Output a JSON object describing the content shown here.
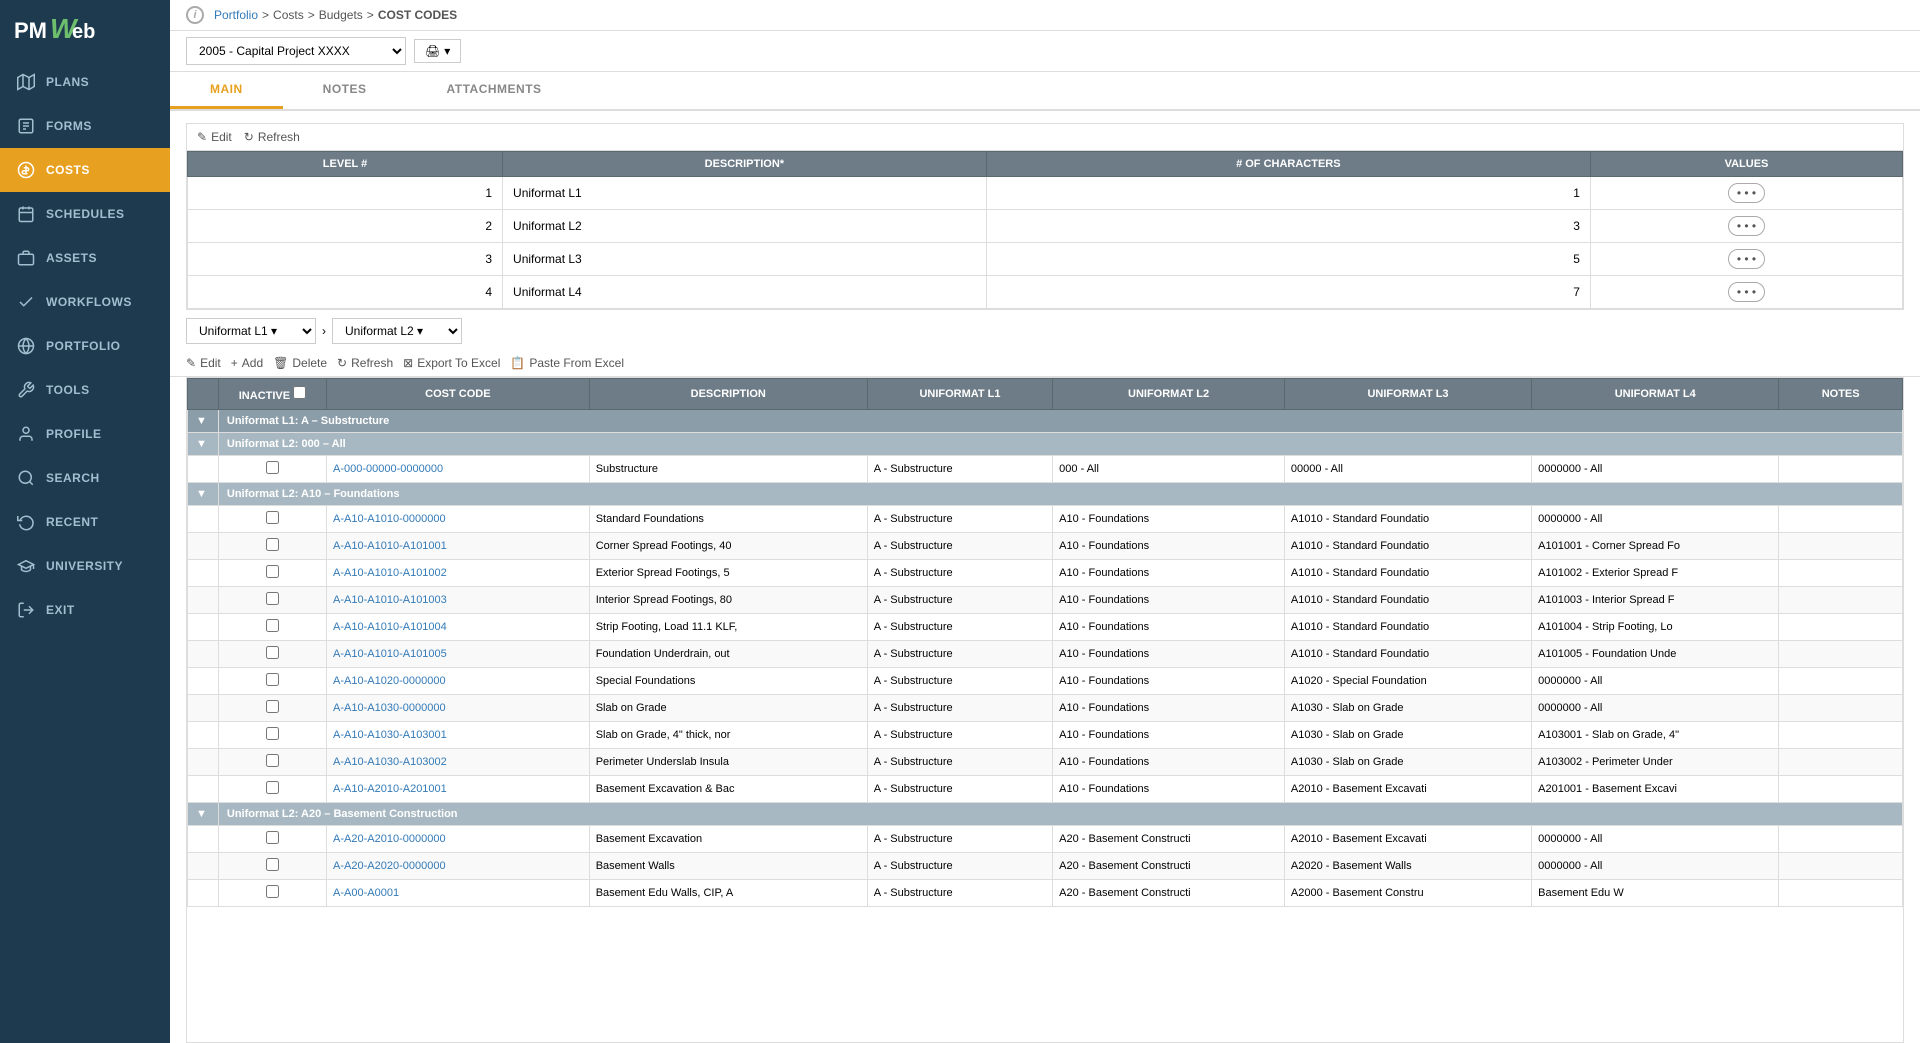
{
  "sidebar": {
    "logo_text": "PMWeb",
    "items": [
      {
        "id": "plans",
        "label": "PLANS",
        "icon": "map-icon"
      },
      {
        "id": "forms",
        "label": "FORMS",
        "icon": "forms-icon"
      },
      {
        "id": "costs",
        "label": "COSTS",
        "icon": "dollar-icon",
        "active": true
      },
      {
        "id": "schedules",
        "label": "SCHEDULES",
        "icon": "calendar-icon"
      },
      {
        "id": "assets",
        "label": "ASSETS",
        "icon": "assets-icon"
      },
      {
        "id": "workflows",
        "label": "WORKFLOWS",
        "icon": "check-icon"
      },
      {
        "id": "portfolio",
        "label": "PORTFOLIO",
        "icon": "globe-icon"
      },
      {
        "id": "tools",
        "label": "TOOLS",
        "icon": "tools-icon"
      },
      {
        "id": "profile",
        "label": "PROFILE",
        "icon": "profile-icon"
      },
      {
        "id": "search",
        "label": "SEARCH",
        "icon": "search-icon"
      },
      {
        "id": "recent",
        "label": "RECENT",
        "icon": "recent-icon"
      },
      {
        "id": "university",
        "label": "UNIVERSITY",
        "icon": "university-icon"
      },
      {
        "id": "exit",
        "label": "EXIT",
        "icon": "exit-icon"
      }
    ]
  },
  "breadcrumb": {
    "portfolio": "Portfolio",
    "costs": "Costs",
    "budgets": "Budgets",
    "page": "COST CODES"
  },
  "project_select": {
    "value": "2005 - Capital Project XXXX"
  },
  "tabs": [
    {
      "id": "main",
      "label": "MAIN",
      "active": true
    },
    {
      "id": "notes",
      "label": "NOTES",
      "active": false
    },
    {
      "id": "attachments",
      "label": "ATTACHMENTS",
      "active": false
    }
  ],
  "settings_section": {
    "edit_label": "Edit",
    "refresh_label": "Refresh",
    "columns": [
      "LEVEL #",
      "DESCRIPTION*",
      "# OF CHARACTERS",
      "VALUES"
    ],
    "rows": [
      {
        "level": "1",
        "description": "Uniformat L1",
        "chars": "1",
        "values": "..."
      },
      {
        "level": "2",
        "description": "Uniformat L2",
        "chars": "3",
        "values": "..."
      },
      {
        "level": "3",
        "description": "Uniformat L3",
        "chars": "5",
        "values": "..."
      },
      {
        "level": "4",
        "description": "Uniformat L4",
        "chars": "7",
        "values": "..."
      }
    ]
  },
  "uniformat_dropdowns": [
    {
      "label": "Uniformat L1",
      "value": "Uniformat L1"
    },
    {
      "label": "Uniformat L2",
      "value": "Uniformat L2"
    }
  ],
  "grid_toolbar": {
    "edit": "Edit",
    "add": "Add",
    "delete": "Delete",
    "refresh": "Refresh",
    "export": "Export To Excel",
    "paste": "Paste From Excel"
  },
  "grid_columns": [
    "INACTIVE",
    "COST CODE",
    "DESCRIPTION",
    "UNIFORMAT L1",
    "UNIFORMAT L2",
    "UNIFORMAT L3",
    "UNIFORMAT L4",
    "NOTES"
  ],
  "grid_data": [
    {
      "type": "group",
      "label": "Uniformat L1: A – Substructure",
      "colspan": 9
    },
    {
      "type": "subgroup",
      "label": "Uniformat L2: 000 – All",
      "colspan": 9
    },
    {
      "type": "row",
      "costcode": "A-000-00000-0000000",
      "description": "Substructure",
      "uni1": "A - Substructure",
      "uni2": "000 - All",
      "uni3": "00000 - All",
      "uni4": "0000000 - All",
      "notes": ""
    },
    {
      "type": "subgroup",
      "label": "Uniformat L2: A10 – Foundations",
      "colspan": 9
    },
    {
      "type": "row",
      "costcode": "A-A10-A1010-0000000",
      "description": "Standard Foundations",
      "uni1": "A - Substructure",
      "uni2": "A10 - Foundations",
      "uni3": "A1010 - Standard Foundatio",
      "uni4": "0000000 - All",
      "notes": ""
    },
    {
      "type": "row",
      "costcode": "A-A10-A1010-A101001",
      "description": "Corner Spread Footings, 40",
      "uni1": "A - Substructure",
      "uni2": "A10 - Foundations",
      "uni3": "A1010 - Standard Foundatio",
      "uni4": "A101001 - Corner Spread Fo",
      "notes": ""
    },
    {
      "type": "row",
      "costcode": "A-A10-A1010-A101002",
      "description": "Exterior Spread Footings, 5",
      "uni1": "A - Substructure",
      "uni2": "A10 - Foundations",
      "uni3": "A1010 - Standard Foundatio",
      "uni4": "A101002 - Exterior Spread F",
      "notes": ""
    },
    {
      "type": "row",
      "costcode": "A-A10-A1010-A101003",
      "description": "Interior Spread Footings, 80",
      "uni1": "A - Substructure",
      "uni2": "A10 - Foundations",
      "uni3": "A1010 - Standard Foundatio",
      "uni4": "A101003 - Interior Spread F",
      "notes": ""
    },
    {
      "type": "row",
      "costcode": "A-A10-A1010-A101004",
      "description": "Strip Footing, Load 11.1 KLF,",
      "uni1": "A - Substructure",
      "uni2": "A10 - Foundations",
      "uni3": "A1010 - Standard Foundatio",
      "uni4": "A101004 - Strip Footing, Lo",
      "notes": ""
    },
    {
      "type": "row",
      "costcode": "A-A10-A1010-A101005",
      "description": "Foundation Underdrain, out",
      "uni1": "A - Substructure",
      "uni2": "A10 - Foundations",
      "uni3": "A1010 - Standard Foundatio",
      "uni4": "A101005 - Foundation Unde",
      "notes": ""
    },
    {
      "type": "row",
      "costcode": "A-A10-A1020-0000000",
      "description": "Special Foundations",
      "uni1": "A - Substructure",
      "uni2": "A10 - Foundations",
      "uni3": "A1020 - Special Foundation",
      "uni4": "0000000 - All",
      "notes": ""
    },
    {
      "type": "row",
      "costcode": "A-A10-A1030-0000000",
      "description": "Slab on Grade",
      "uni1": "A - Substructure",
      "uni2": "A10 - Foundations",
      "uni3": "A1030 - Slab on Grade",
      "uni4": "0000000 - All",
      "notes": ""
    },
    {
      "type": "row",
      "costcode": "A-A10-A1030-A103001",
      "description": "Slab on Grade, 4\" thick, nor",
      "uni1": "A - Substructure",
      "uni2": "A10 - Foundations",
      "uni3": "A1030 - Slab on Grade",
      "uni4": "A103001 - Slab on Grade, 4\"",
      "notes": ""
    },
    {
      "type": "row",
      "costcode": "A-A10-A1030-A103002",
      "description": "Perimeter Underslab Insula",
      "uni1": "A - Substructure",
      "uni2": "A10 - Foundations",
      "uni3": "A1030 - Slab on Grade",
      "uni4": "A103002 - Perimeter Under",
      "notes": ""
    },
    {
      "type": "row",
      "costcode": "A-A10-A2010-A201001",
      "description": "Basement Excavation & Bac",
      "uni1": "A - Substructure",
      "uni2": "A10 - Foundations",
      "uni3": "A2010 - Basement Excavati",
      "uni4": "A201001 - Basement Excavi",
      "notes": ""
    },
    {
      "type": "subgroup",
      "label": "Uniformat L2: A20 – Basement Construction",
      "colspan": 9
    },
    {
      "type": "row",
      "costcode": "A-A20-A2010-0000000",
      "description": "Basement Excavation",
      "uni1": "A - Substructure",
      "uni2": "A20 - Basement Constructi",
      "uni3": "A2010 - Basement Excavati",
      "uni4": "0000000 - All",
      "notes": ""
    },
    {
      "type": "row",
      "costcode": "A-A20-A2020-0000000",
      "description": "Basement Walls",
      "uni1": "A - Substructure",
      "uni2": "A20 - Basement Constructi",
      "uni3": "A2020 - Basement Walls",
      "uni4": "0000000 - All",
      "notes": ""
    },
    {
      "type": "row",
      "costcode": "A-A00-A0001",
      "description": "Basement Edu Walls, CIP, A",
      "uni1": "A - Substructure",
      "uni2": "A20 - Basement Constructi",
      "uni3": "A2000 - Basement Constru",
      "uni4": "Basement Edu W",
      "notes": ""
    }
  ]
}
